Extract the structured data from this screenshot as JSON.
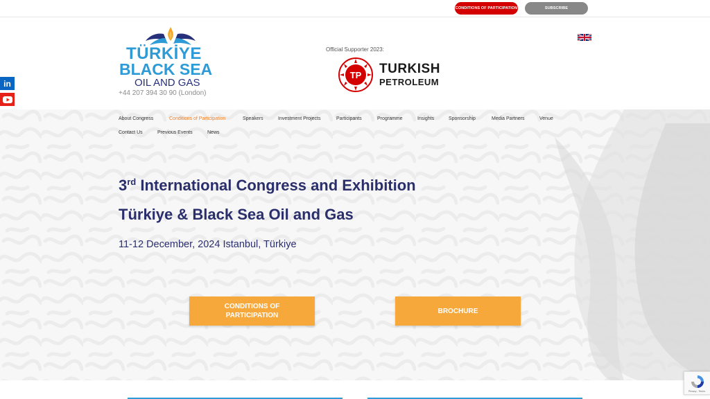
{
  "topbar": {
    "conditions_label": "CONDITIONS OF PARTICIPATION",
    "subscribe_label": "SUBSCRIBE"
  },
  "header": {
    "logo_line1": "TÜRKİYE",
    "logo_line2": "BLACK SEA",
    "logo_line3": "OIL AND GAS",
    "phone": "+44 207 394 30 90 (London)",
    "supporter_label": "Official Supporter 2023:",
    "tp_badge": "TP",
    "tp_line1": "TURKISH",
    "tp_line2": "PETROLEUM"
  },
  "social": {
    "linkedin_label": "in"
  },
  "nav": {
    "items": [
      {
        "label": "About Congress"
      },
      {
        "label": "Conditions of Participation",
        "active": true
      },
      {
        "label": "Speakers"
      },
      {
        "label": "Investment Projects"
      },
      {
        "label": "Participants"
      },
      {
        "label": "Programme"
      },
      {
        "label": "Insights"
      },
      {
        "label": "Sponsorship"
      },
      {
        "label": "Media Partners"
      },
      {
        "label": "Venue"
      },
      {
        "label": "Contact Us"
      },
      {
        "label": "Previous Events"
      },
      {
        "label": "News"
      }
    ]
  },
  "hero": {
    "title_num": "3",
    "title_sup": "rd",
    "title_rest": " International Congress and Exhibition",
    "title_line2": "Türkiye & Black Sea Oil and Gas",
    "date": "11-12 December, 2024 Istanbul, Türkiye",
    "btn_conditions_l1": "CONDITIONS OF",
    "btn_conditions_l2": "PARTICIPATION",
    "btn_brochure": "BROCHURE"
  },
  "recaptcha": {
    "footer": "Privacy - Terms"
  },
  "colors": {
    "accent_blue": "#2e9bd6",
    "navy": "#2a2f6b",
    "red": "#d40000",
    "orange": "#f7a83b",
    "nav_active": "#f07d22"
  }
}
